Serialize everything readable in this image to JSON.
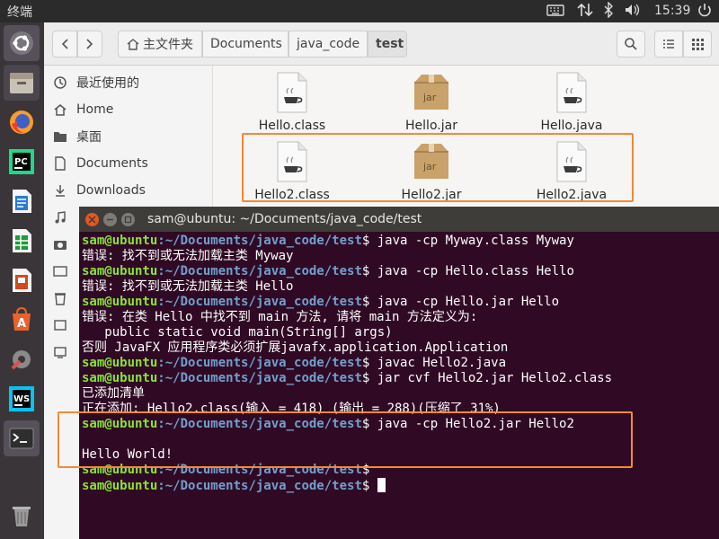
{
  "topbar": {
    "title": "终端",
    "time": "15:39",
    "indicators": [
      "keyboard-icon",
      "network-transfer-icon",
      "bluetooth-icon",
      "volume-icon",
      "power-icon"
    ]
  },
  "launcher": {
    "apps": [
      "ubuntu-dash-icon",
      "files-icon",
      "firefox-icon",
      "pycharm-icon",
      "writer-icon",
      "calc-icon",
      "impress-icon",
      "software-center-icon",
      "settings-icon",
      "webstorm-icon",
      "terminal-icon",
      "trash-icon"
    ]
  },
  "files": {
    "breadcrumb": [
      "主文件夹",
      "Documents",
      "java_code",
      "test"
    ],
    "sidebar": [
      {
        "label": "最近使用的",
        "icon": "clock-icon"
      },
      {
        "label": "Home",
        "icon": "home-icon"
      },
      {
        "label": "桌面",
        "icon": "desktop-folder-icon"
      },
      {
        "label": "Documents",
        "icon": "document-icon"
      },
      {
        "label": "Downloads",
        "icon": "download-icon"
      }
    ],
    "items": [
      {
        "name": "Hello.class",
        "icon": "java-class-icon"
      },
      {
        "name": "Hello.jar",
        "icon": "jar-icon"
      },
      {
        "name": "Hello.java",
        "icon": "java-source-icon"
      },
      {
        "name": "Hello2.class",
        "icon": "java-class-icon"
      },
      {
        "name": "Hello2.jar",
        "icon": "jar-icon"
      },
      {
        "name": "Hello2.java",
        "icon": "java-source-icon"
      }
    ]
  },
  "terminal": {
    "title": "sam@ubuntu: ~/Documents/java_code/test",
    "prompt_user": "sam@ubuntu",
    "prompt_path": ":~/Documents/java_code/test",
    "prompt_end": "$ ",
    "lines": [
      {
        "prompt": true,
        "text": "java -cp Myway.class Myway"
      },
      {
        "prompt": false,
        "text": "错误: 找不到或无法加载主类 Myway"
      },
      {
        "prompt": true,
        "text": "java -cp Hello.class Hello"
      },
      {
        "prompt": false,
        "text": "错误: 找不到或无法加载主类 Hello"
      },
      {
        "prompt": true,
        "text": "java -cp Hello.jar Hello"
      },
      {
        "prompt": false,
        "text": "错误: 在类 Hello 中找不到 main 方法, 请将 main 方法定义为:"
      },
      {
        "prompt": false,
        "text": "   public static void main(String[] args)"
      },
      {
        "prompt": false,
        "text": "否则 JavaFX 应用程序类必须扩展javafx.application.Application"
      },
      {
        "prompt": true,
        "text": "javac Hello2.java"
      },
      {
        "prompt": true,
        "text": "jar cvf Hello2.jar Hello2.class"
      },
      {
        "prompt": false,
        "text": "已添加清单"
      },
      {
        "prompt": false,
        "text": "正在添加: Hello2.class(输入 = 418) (输出 = 288)(压缩了 31%)"
      },
      {
        "prompt": true,
        "text": "java -cp Hello2.jar Hello2"
      },
      {
        "prompt": false,
        "text": ""
      },
      {
        "prompt": false,
        "text": "Hello World!"
      },
      {
        "prompt": true,
        "text": ""
      },
      {
        "prompt": true,
        "text": "",
        "cursor": true
      }
    ]
  },
  "colors": {
    "terminal_bg": "#300a24",
    "prompt_user": "#8ae234",
    "prompt_path": "#729fcf",
    "highlight": "#f08a3a",
    "launcher_bg": "#3a3539"
  }
}
